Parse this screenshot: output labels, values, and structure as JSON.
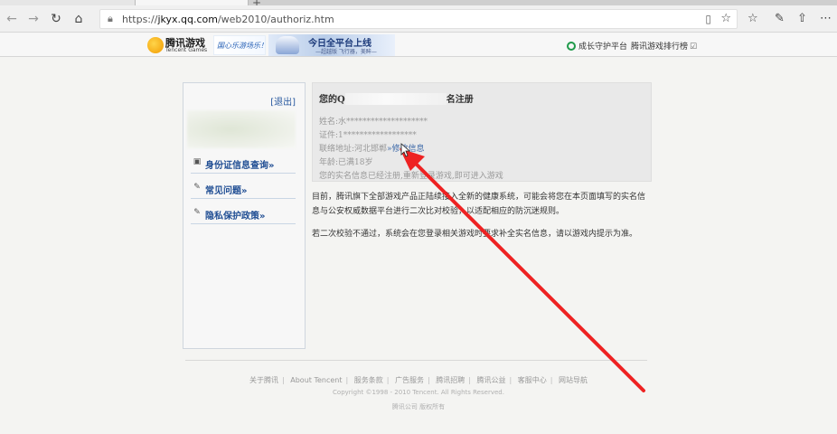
{
  "browser": {
    "url_prefix": "https://",
    "url_domain": "jkyx.qq.com",
    "url_path": "/web2010/authoriz.htm",
    "new_tab_glyph": "+"
  },
  "site_header": {
    "logo_text": "腾讯游戏",
    "logo_sub": "Tencent Games",
    "banner1_text": "国心乐游场乐！",
    "banner2_title": "今日全平台上线",
    "banner2_sub": "—超越版 飞行器，美眸—",
    "link_guard": "成长守护平台",
    "link_rank": "腾讯游戏排行榜"
  },
  "sidebar": {
    "logout": "[退出]",
    "items": [
      {
        "label": "身份证信息查询»",
        "icon": "id-card-icon"
      },
      {
        "label": "常见问题»",
        "icon": "pencil-icon"
      },
      {
        "label": "隐私保护政策»",
        "icon": "pencil-icon"
      }
    ]
  },
  "info": {
    "title_prefix": "您的Q",
    "title_suffix": "名注册",
    "name_line": "姓名:水********************",
    "id_line": "证件:1******************",
    "address_prefix": "联络地址:河北邯郸",
    "address_link": "»修改信息",
    "age_line": "年龄:已满18岁",
    "note_line": "您的实名信息已经注册,重新登录游戏,即可进入游戏"
  },
  "paragraphs": {
    "p1": "目前，腾讯旗下全部游戏产品正陆续接入全新的健康系统，可能会将您在本页面填写的实名信息与公安权威数据平台进行二次比对校验，以适配相应的防沉迷规则。",
    "p2": "若二次校验不通过，系统会在您登录相关游戏时要求补全实名信息，请以游戏内提示为准。"
  },
  "footer": {
    "links": [
      "关于腾讯",
      "About Tencent",
      "服务条款",
      "广告服务",
      "腾讯招聘",
      "腾讯公益",
      "客服中心",
      "网站导航"
    ],
    "copyright": "Copyright ©1998 - 2010 Tencent. All Rights Reserved.",
    "rights": "腾讯公司 版权所有"
  },
  "colors": {
    "annotation_arrow": "#ee2222",
    "link_blue": "#1f4d93"
  }
}
